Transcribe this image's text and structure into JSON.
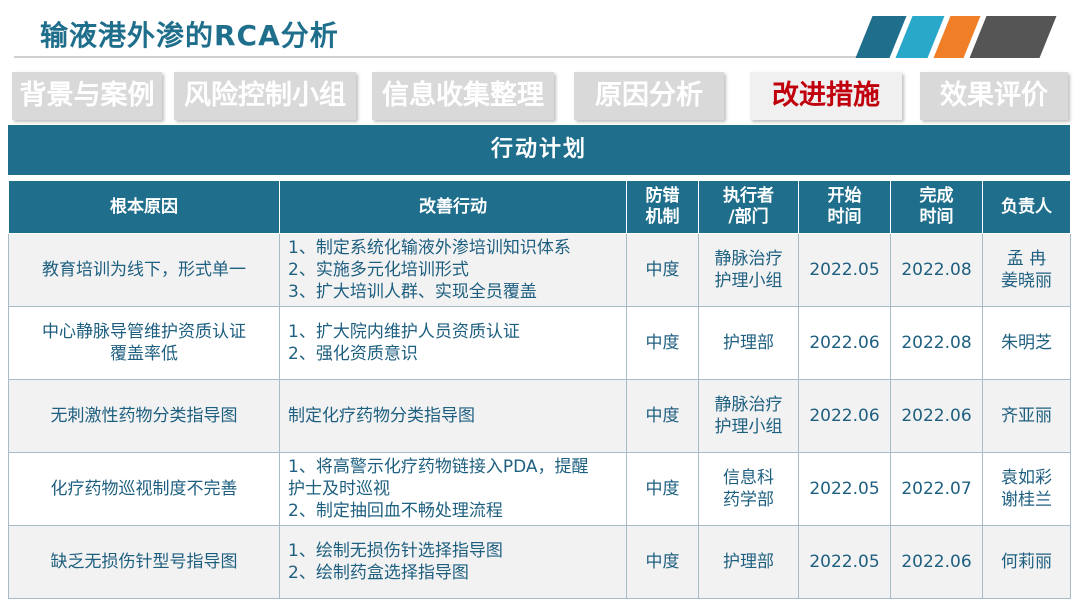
{
  "title": "输液港外渗的RCA分析",
  "colors": {
    "accent": "#1f6f8c",
    "active_tab_text": "#c0000c",
    "stripe_blue": "#1f6f8c",
    "stripe_cyan": "#29a8c9",
    "stripe_orange": "#f07e26",
    "stripe_gray": "#555555"
  },
  "nav": [
    {
      "label": "背景与案例"
    },
    {
      "label": "风险控制小组"
    },
    {
      "label": "信息收集整理"
    },
    {
      "label": "原因分析"
    },
    {
      "label": "改进措施"
    },
    {
      "label": "效果评价"
    }
  ],
  "section_title": "行动计划",
  "table": {
    "headers": [
      {
        "lines": [
          "根本原因"
        ]
      },
      {
        "lines": [
          "改善行动"
        ]
      },
      {
        "lines": [
          "防错",
          "机制"
        ]
      },
      {
        "lines": [
          "执行者",
          "/部门"
        ]
      },
      {
        "lines": [
          "开始",
          "时间"
        ]
      },
      {
        "lines": [
          "完成",
          "时间"
        ]
      },
      {
        "lines": [
          "负责人"
        ]
      }
    ],
    "rows": [
      {
        "cause": [
          "教育培训为线下，形式单一"
        ],
        "actions": [
          "1、制定系统化输液外渗培训知识体系",
          "2、实施多元化培训形式",
          "3、扩大培训人群、实现全员覆盖"
        ],
        "mechanism": "中度",
        "dept": [
          "静脉治疗",
          "护理小组"
        ],
        "start": "2022.05",
        "end": "2022.08",
        "owner": [
          "孟 冉",
          "姜晓丽"
        ]
      },
      {
        "cause": [
          "中心静脉导管维护资质认证",
          "覆盖率低"
        ],
        "actions": [
          "1、扩大院内维护人员资质认证",
          "2、强化资质意识"
        ],
        "mechanism": "中度",
        "dept": [
          "护理部"
        ],
        "start": "2022.06",
        "end": "2022.08",
        "owner": [
          "朱明芝"
        ]
      },
      {
        "cause": [
          "无刺激性药物分类指导图"
        ],
        "actions": [
          "制定化疗药物分类指导图"
        ],
        "mechanism": "中度",
        "dept": [
          "静脉治疗",
          "护理小组"
        ],
        "start": "2022.06",
        "end": "2022.06",
        "owner": [
          "齐亚丽"
        ]
      },
      {
        "cause": [
          "化疗药物巡视制度不完善"
        ],
        "actions": [
          "1、将高警示化疗药物链接入PDA，提醒",
          "护士及时巡视",
          "2、制定抽回血不畅处理流程"
        ],
        "mechanism": "中度",
        "dept": [
          "信息科",
          "药学部"
        ],
        "start": "2022.05",
        "end": "2022.07",
        "owner": [
          "袁如彩",
          "谢桂兰"
        ]
      },
      {
        "cause": [
          "缺乏无损伤针型号指导图"
        ],
        "actions": [
          "1、绘制无损伤针选择指导图",
          "2、绘制药盒选择指导图"
        ],
        "mechanism": "中度",
        "dept": [
          "护理部"
        ],
        "start": "2022.05",
        "end": "2022.06",
        "owner": [
          "何莉丽"
        ]
      }
    ]
  }
}
